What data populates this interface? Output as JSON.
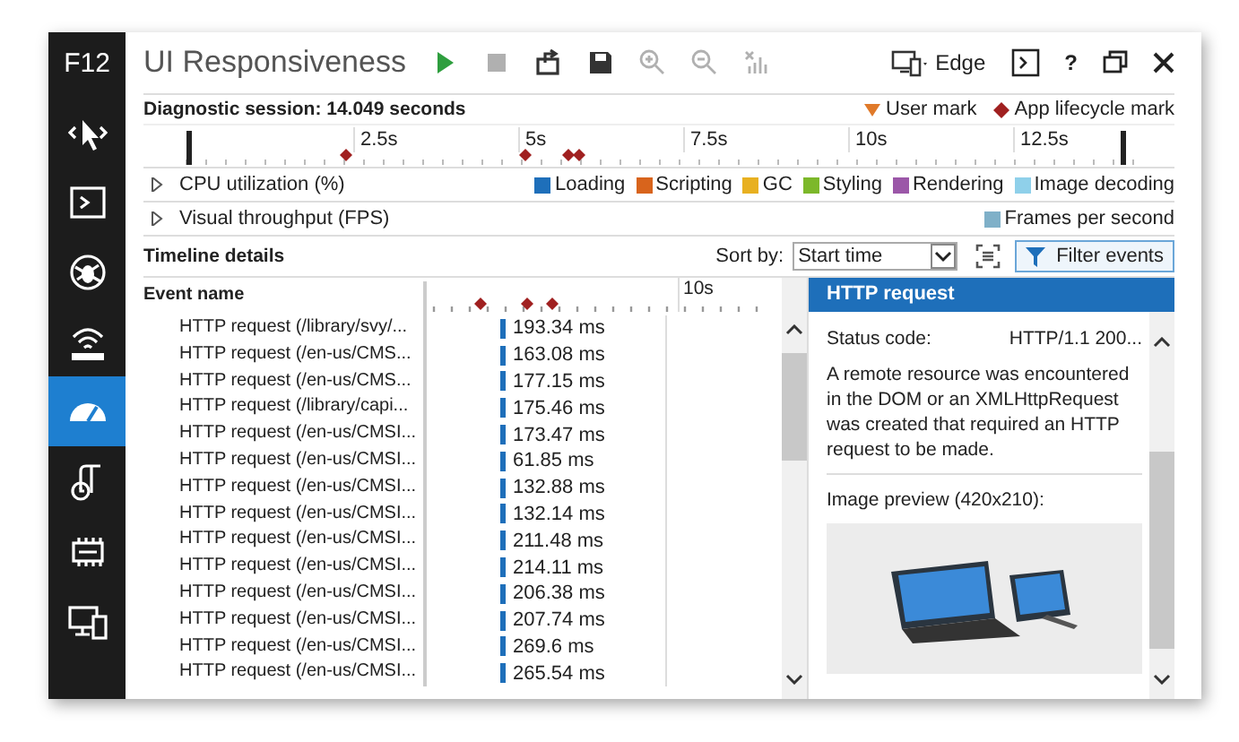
{
  "sidebar": {
    "label": "F12",
    "items": [
      {
        "kind": "dom",
        "selected": false
      },
      {
        "kind": "console",
        "selected": false
      },
      {
        "kind": "debugger",
        "selected": false
      },
      {
        "kind": "network",
        "selected": false
      },
      {
        "kind": "performance",
        "selected": true
      },
      {
        "kind": "memory",
        "selected": false
      },
      {
        "kind": "emulation",
        "selected": false
      },
      {
        "kind": "devices",
        "selected": false
      }
    ]
  },
  "window": {
    "title": "UI Responsiveness"
  },
  "toolbar": [
    {
      "kind": "play",
      "disabled": false
    },
    {
      "kind": "stop",
      "disabled": true
    },
    {
      "kind": "export",
      "disabled": false
    },
    {
      "kind": "save",
      "disabled": false
    },
    {
      "kind": "zoom-in",
      "disabled": true
    },
    {
      "kind": "zoom-out",
      "disabled": true
    },
    {
      "kind": "reset-zoom",
      "disabled": true
    }
  ],
  "target": {
    "label": "Edge"
  },
  "window_buttons": [
    {
      "kind": "console"
    },
    {
      "kind": "help",
      "text": "?"
    },
    {
      "kind": "undock"
    },
    {
      "kind": "close"
    }
  ],
  "session": {
    "label": "Diagnostic session: 14.049 seconds",
    "marks": [
      {
        "kind": "user",
        "label": "User mark"
      },
      {
        "kind": "app",
        "label": "App lifecycle mark"
      }
    ],
    "ticks": [
      "2.5s",
      "5s",
      "7.5s",
      "10s",
      "12.5s"
    ]
  },
  "cpu": {
    "label": "CPU utilization (%)",
    "expanded": false,
    "legend": [
      {
        "label": "Loading",
        "color": "#1e6fba"
      },
      {
        "label": "Scripting",
        "color": "#d8641c"
      },
      {
        "label": "GC",
        "color": "#e8b020"
      },
      {
        "label": "Styling",
        "color": "#7cb82a"
      },
      {
        "label": "Rendering",
        "color": "#9b57a8"
      },
      {
        "label": "Image decoding",
        "color": "#8fd0ea"
      }
    ]
  },
  "fps": {
    "label": "Visual throughput (FPS)",
    "expanded": false,
    "legend": [
      {
        "label": "Frames per second",
        "color": "#7fb0c8"
      }
    ]
  },
  "details": {
    "title": "Timeline details",
    "sort_label": "Sort by:",
    "sort_value": "Start time",
    "filter_button": "Filter events",
    "column_header": "Event name",
    "timeline_tick": "10s",
    "rows": [
      {
        "name": "HTTP request (/library/svy/...",
        "duration": "193.34 ms"
      },
      {
        "name": "HTTP request (/en-us/CMS...",
        "duration": "163.08 ms"
      },
      {
        "name": "HTTP request (/en-us/CMS...",
        "duration": "177.15 ms"
      },
      {
        "name": "HTTP request (/library/capi...",
        "duration": "175.46 ms"
      },
      {
        "name": "HTTP request (/en-us/CMSI...",
        "duration": "173.47 ms"
      },
      {
        "name": "HTTP request (/en-us/CMSI...",
        "duration": "61.85 ms"
      },
      {
        "name": "HTTP request (/en-us/CMSI...",
        "duration": "132.88 ms"
      },
      {
        "name": "HTTP request (/en-us/CMSI...",
        "duration": "132.14 ms"
      },
      {
        "name": "HTTP request (/en-us/CMSI...",
        "duration": "211.48 ms"
      },
      {
        "name": "HTTP request (/en-us/CMSI...",
        "duration": "214.11 ms"
      },
      {
        "name": "HTTP request (/en-us/CMSI...",
        "duration": "206.38 ms"
      },
      {
        "name": "HTTP request (/en-us/CMSI...",
        "duration": "207.74 ms"
      },
      {
        "name": "HTTP request (/en-us/CMSI...",
        "duration": "269.6 ms"
      },
      {
        "name": "HTTP request (/en-us/CMSI...",
        "duration": "265.54 ms"
      }
    ]
  },
  "event_panel": {
    "title": "HTTP request",
    "fields": [
      {
        "label": "Status code:",
        "value": "HTTP/1.1 200..."
      }
    ],
    "description": "A remote resource was encountered in the DOM or an XMLHttpRequest was created that required an HTTP request to be made.",
    "preview_label": "Image preview (420x210):"
  }
}
